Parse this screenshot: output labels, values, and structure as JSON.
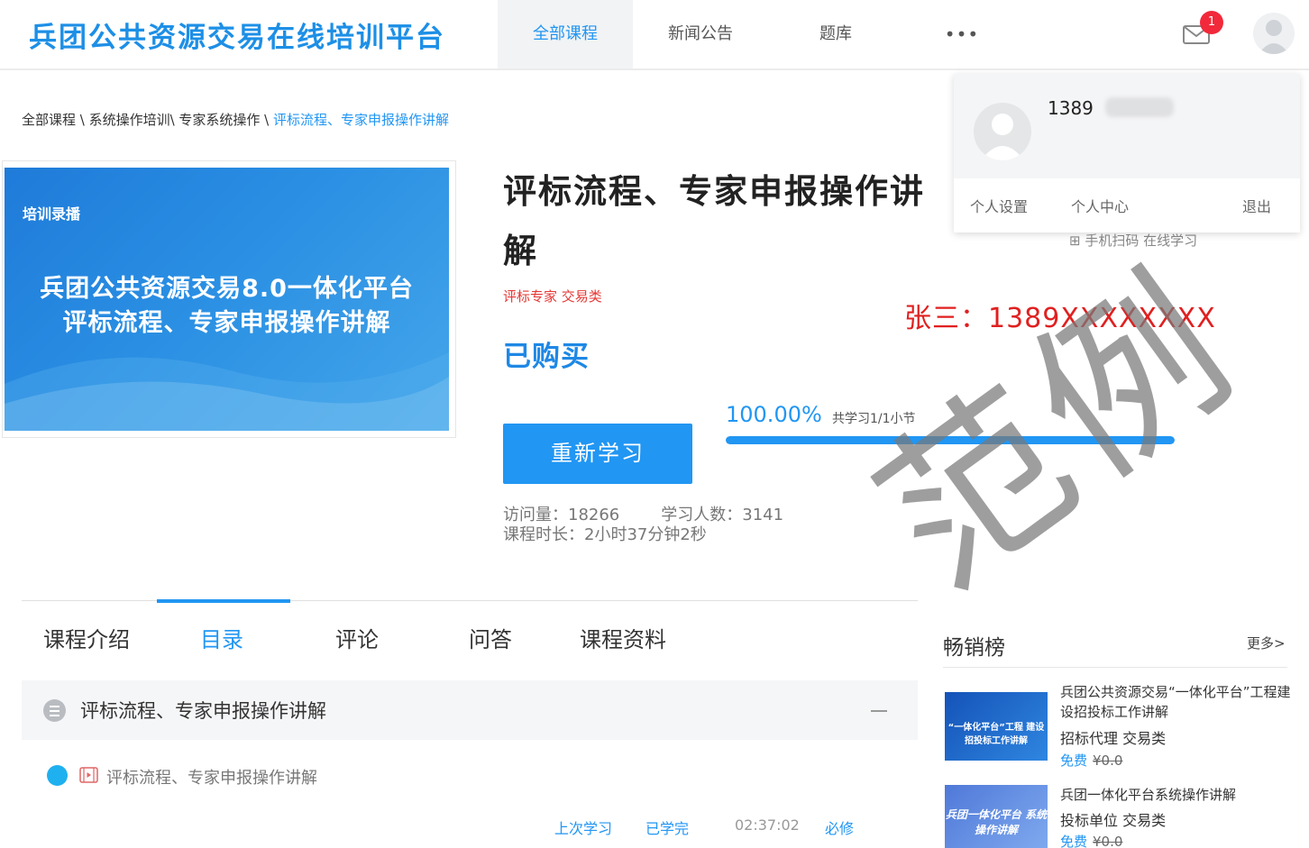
{
  "header": {
    "logo": "兵团公共资源交易在线培训平台",
    "nav": [
      "全部课程",
      "新闻公告",
      "题库",
      "•••"
    ],
    "notification_count": "1"
  },
  "breadcrumb": {
    "path": "全部课程 \\ 系统操作培训\\ 专家系统操作 \\ ",
    "current": "评标流程、专家申报操作讲解"
  },
  "cover": {
    "tag": "培训录播",
    "line1": "兵团公共资源交易8.0一体化平台",
    "line2": "评标流程、专家申报操作讲解"
  },
  "course": {
    "title": "评标流程、专家申报操作讲解",
    "tags": "评标专家 交易类",
    "status": "已购买",
    "restudy_label": "重新学习",
    "progress_pct": "100.00%",
    "progress_fraction": 1.0,
    "progress_note": "共学习1/1小节",
    "visits": "访问量：18266",
    "learners": "学习人数：3141",
    "duration": "课程时长：2小时37分钟2秒"
  },
  "user_menu": {
    "phone": "1389",
    "settings": "个人设置",
    "center": "个人中心",
    "logout": "退出",
    "scan_hint": "手机扫码 在线学习"
  },
  "overlay": {
    "example_label": "张三：1389XXXXXXXX",
    "watermark": "范例"
  },
  "tabs": [
    "课程介绍",
    "目录",
    "评论",
    "问答",
    "课程资料"
  ],
  "chapter": {
    "title": "评标流程、专家申报操作讲解",
    "lesson_title": "评标流程、专家申报操作讲解",
    "last_study": "上次学习",
    "completed": "已学完",
    "time": "02:37:02",
    "required": "必修"
  },
  "sidebar": {
    "title": "畅销榜",
    "more": "更多>",
    "items": [
      {
        "title": "兵团公共资源交易“一体化平台”工程建设招投标工作讲解",
        "cats": "招标代理 交易类",
        "free": "免费",
        "orig_price": "¥0.0",
        "thumb_text": "“一体化平台”工程 建设招投标工作讲解"
      },
      {
        "title": "兵团一体化平台系统操作讲解",
        "cats": "投标单位 交易类",
        "free": "免费",
        "orig_price": "¥0.0",
        "thumb_text": "兵团一体化平台 系统操作讲解"
      }
    ]
  },
  "colors": {
    "accent": "#2196f3",
    "badge": "#f2293a",
    "tag_red": "#e53935"
  }
}
